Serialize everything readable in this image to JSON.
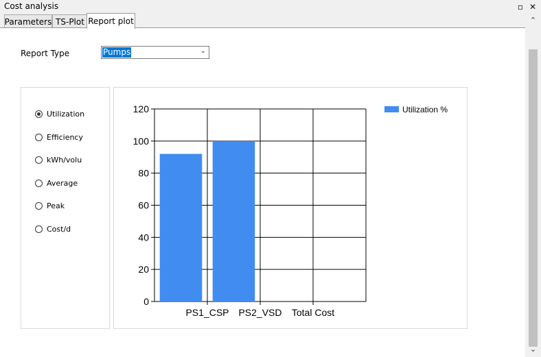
{
  "window": {
    "title": "Cost analysis",
    "pin_icon": "pin-icon",
    "close_icon": "close-icon"
  },
  "tabs": [
    {
      "label": "Parameters",
      "active": false
    },
    {
      "label": "TS-Plot",
      "active": false
    },
    {
      "label": "Report plot",
      "active": true
    }
  ],
  "report_type": {
    "label": "Report Type",
    "value": "Pumps"
  },
  "radios": [
    {
      "label": "Utilization",
      "checked": true
    },
    {
      "label": "Efficiency",
      "checked": false
    },
    {
      "label": "kWh/volu",
      "checked": false
    },
    {
      "label": "Average",
      "checked": false
    },
    {
      "label": "Peak",
      "checked": false
    },
    {
      "label": "Cost/d",
      "checked": false
    }
  ],
  "chart_data": {
    "type": "bar",
    "categories": [
      "PS1_CSP",
      "PS2_VSD",
      "Total Cost"
    ],
    "series": [
      {
        "name": "Utilization %",
        "values": [
          92,
          100,
          0
        ],
        "color": "#418cf0"
      }
    ],
    "ylim": [
      0,
      120
    ],
    "yticks": [
      0,
      20,
      40,
      60,
      80,
      100,
      120
    ],
    "grid": true,
    "legend": "top-right"
  }
}
